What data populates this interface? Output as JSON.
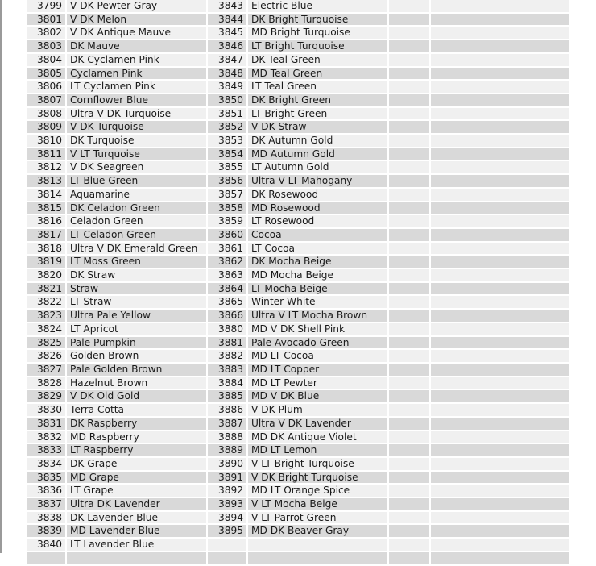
{
  "table": {
    "rows": [
      {
        "a_num": "3799",
        "a_name": "V DK Pewter Gray",
        "b_num": "3843",
        "b_name": "Electric Blue"
      },
      {
        "a_num": "3801",
        "a_name": "V DK Melon",
        "b_num": "3844",
        "b_name": "DK Bright Turquoise"
      },
      {
        "a_num": "3802",
        "a_name": "V DK Antique Mauve",
        "b_num": "3845",
        "b_name": "MD Bright Turquoise"
      },
      {
        "a_num": "3803",
        "a_name": "DK Mauve",
        "b_num": "3846",
        "b_name": "LT Bright Turquoise"
      },
      {
        "a_num": "3804",
        "a_name": "DK Cyclamen Pink",
        "b_num": "3847",
        "b_name": "DK Teal Green"
      },
      {
        "a_num": "3805",
        "a_name": "Cyclamen Pink",
        "b_num": "3848",
        "b_name": "MD Teal Green"
      },
      {
        "a_num": "3806",
        "a_name": "LT Cyclamen Pink",
        "b_num": "3849",
        "b_name": "LT Teal Green"
      },
      {
        "a_num": "3807",
        "a_name": "Cornflower Blue",
        "b_num": "3850",
        "b_name": "DK Bright Green"
      },
      {
        "a_num": "3808",
        "a_name": "Ultra V DK Turquoise",
        "b_num": "3851",
        "b_name": "LT Bright Green"
      },
      {
        "a_num": "3809",
        "a_name": "V DK Turquoise",
        "b_num": "3852",
        "b_name": "V DK Straw"
      },
      {
        "a_num": "3810",
        "a_name": "DK Turquoise",
        "b_num": "3853",
        "b_name": "DK Autumn Gold"
      },
      {
        "a_num": "3811",
        "a_name": "V LT Turquoise",
        "b_num": "3854",
        "b_name": "MD Autumn Gold"
      },
      {
        "a_num": "3812",
        "a_name": "V DK Seagreen",
        "b_num": "3855",
        "b_name": "LT Autumn Gold"
      },
      {
        "a_num": "3813",
        "a_name": "LT Blue Green",
        "b_num": "3856",
        "b_name": "Ultra V LT Mahogany"
      },
      {
        "a_num": "3814",
        "a_name": "Aquamarine",
        "b_num": "3857",
        "b_name": "DK Rosewood"
      },
      {
        "a_num": "3815",
        "a_name": "DK Celadon Green",
        "b_num": "3858",
        "b_name": "MD Rosewood"
      },
      {
        "a_num": "3816",
        "a_name": "Celadon Green",
        "b_num": "3859",
        "b_name": "LT Rosewood"
      },
      {
        "a_num": "3817",
        "a_name": "LT Celadon Green",
        "b_num": "3860",
        "b_name": "Cocoa"
      },
      {
        "a_num": "3818",
        "a_name": "Ultra V DK Emerald Green",
        "b_num": "3861",
        "b_name": "LT Cocoa"
      },
      {
        "a_num": "3819",
        "a_name": "LT Moss Green",
        "b_num": "3862",
        "b_name": "DK Mocha Beige"
      },
      {
        "a_num": "3820",
        "a_name": "DK Straw",
        "b_num": "3863",
        "b_name": "MD Mocha Beige"
      },
      {
        "a_num": "3821",
        "a_name": "Straw",
        "b_num": "3864",
        "b_name": "LT Mocha Beige"
      },
      {
        "a_num": "3822",
        "a_name": "LT Straw",
        "b_num": "3865",
        "b_name": "Winter White"
      },
      {
        "a_num": "3823",
        "a_name": "Ultra Pale Yellow",
        "b_num": "3866",
        "b_name": "Ultra V LT Mocha Brown"
      },
      {
        "a_num": "3824",
        "a_name": "LT Apricot",
        "b_num": "3880",
        "b_name": "MD V DK Shell Pink"
      },
      {
        "a_num": "3825",
        "a_name": "Pale Pumpkin",
        "b_num": "3881",
        "b_name": "Pale Avocado Green"
      },
      {
        "a_num": "3826",
        "a_name": "Golden Brown",
        "b_num": "3882",
        "b_name": "MD LT Cocoa"
      },
      {
        "a_num": "3827",
        "a_name": "Pale Golden Brown",
        "b_num": "3883",
        "b_name": "MD LT Copper"
      },
      {
        "a_num": "3828",
        "a_name": "Hazelnut Brown",
        "b_num": "3884",
        "b_name": "MD LT Pewter"
      },
      {
        "a_num": "3829",
        "a_name": "V DK Old Gold",
        "b_num": "3885",
        "b_name": "MD V DK Blue"
      },
      {
        "a_num": "3830",
        "a_name": "Terra Cotta",
        "b_num": "3886",
        "b_name": "V DK Plum"
      },
      {
        "a_num": "3831",
        "a_name": "DK Raspberry",
        "b_num": "3887",
        "b_name": "Ultra V DK Lavender"
      },
      {
        "a_num": "3832",
        "a_name": "MD Raspberry",
        "b_num": "3888",
        "b_name": "MD DK Antique Violet"
      },
      {
        "a_num": "3833",
        "a_name": "LT Raspberry",
        "b_num": "3889",
        "b_name": "MD LT Lemon"
      },
      {
        "a_num": "3834",
        "a_name": "DK Grape",
        "b_num": "3890",
        "b_name": "V LT Bright Turquoise"
      },
      {
        "a_num": "3835",
        "a_name": "MD Grape",
        "b_num": "3891",
        "b_name": "V DK Bright Turquoise"
      },
      {
        "a_num": "3836",
        "a_name": "LT Grape",
        "b_num": "3892",
        "b_name": "MD LT Orange Spice"
      },
      {
        "a_num": "3837",
        "a_name": "Ultra DK Lavender",
        "b_num": "3893",
        "b_name": "V LT Mocha Beige"
      },
      {
        "a_num": "3838",
        "a_name": "DK Lavender Blue",
        "b_num": "3894",
        "b_name": "V LT Parrot Green"
      },
      {
        "a_num": "3839",
        "a_name": "MD Lavender Blue",
        "b_num": "3895",
        "b_name": "MD DK Beaver Gray"
      },
      {
        "a_num": "3840",
        "a_name": "LT Lavender Blue",
        "b_num": "",
        "b_name": ""
      },
      {
        "a_num": "",
        "a_name": "",
        "b_num": "",
        "b_name": ""
      }
    ]
  },
  "colors": {
    "row_light": "#f0f0f0",
    "row_dark": "#d9d9d9",
    "text": "#1a1a1a",
    "left_rule": "#9a9a9a"
  }
}
